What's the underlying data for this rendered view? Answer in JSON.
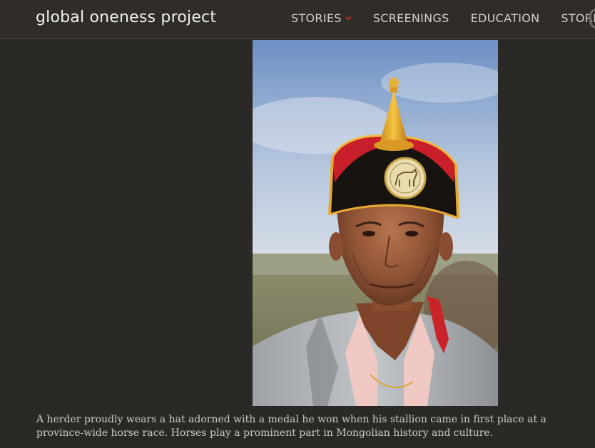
{
  "header": {
    "logo": "global oneness project",
    "nav": [
      {
        "label": "STORIES",
        "has_dropdown": true
      },
      {
        "label": "SCREENINGS",
        "has_dropdown": false
      },
      {
        "label": "EDUCATION",
        "has_dropdown": false
      },
      {
        "label": "STORE",
        "has_dropdown": false
      }
    ],
    "accent_color": "#c8322a"
  },
  "photo": {
    "icon": "photo-herder-portrait"
  },
  "caption": {
    "text": "A herder proudly wears a hat adorned with a medal he won when his stallion came in first place at a province-wide horse race. Horses play a prominent part in Mongolian history and culture."
  }
}
